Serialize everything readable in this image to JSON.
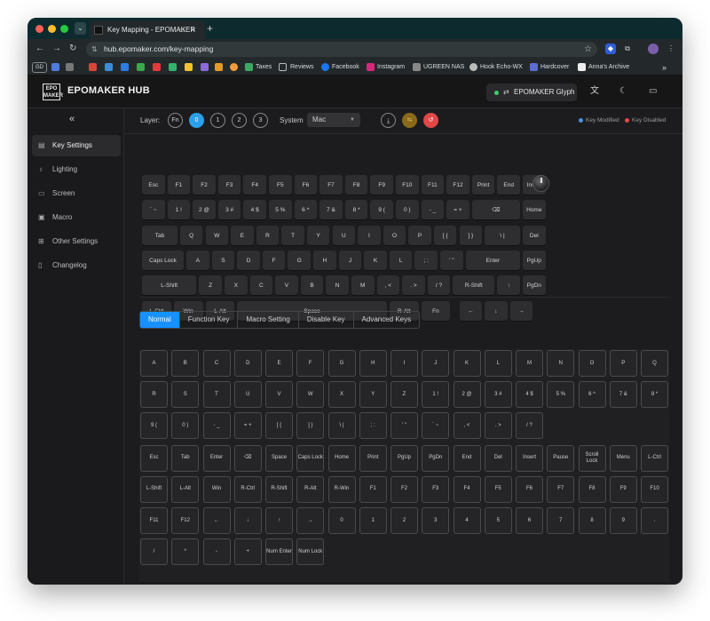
{
  "browser": {
    "tab_title": "Key Mapping - EPOMAKER",
    "url": "hub.epomaker.com/key-mapping",
    "bookmarks": [
      "Taxes",
      "Reviews",
      "Facebook",
      "Instagram",
      "UGREEN NAS",
      "Hook Echo-WX",
      "Hardcover",
      "Anna's Archive"
    ],
    "gd_label": "GD"
  },
  "header": {
    "logo_text": "EPO MAKER",
    "brand": "EPOMAKER HUB",
    "device_name": "EPOMAKER Glyph"
  },
  "sidebar": {
    "items": [
      {
        "label": "Key Settings",
        "icon": "keyboard-icon"
      },
      {
        "label": "Lighting",
        "icon": "bulb-icon"
      },
      {
        "label": "Screen",
        "icon": "monitor-icon"
      },
      {
        "label": "Macro",
        "icon": "macro-icon"
      },
      {
        "label": "Other Settings",
        "icon": "grid-icon"
      },
      {
        "label": "Changelog",
        "icon": "document-icon"
      }
    ]
  },
  "layerbar": {
    "layer_label": "Layer:",
    "layers": [
      "Fn",
      "0",
      "1",
      "2",
      "3"
    ],
    "active_layer": "0",
    "system_label": "System",
    "system_value": "Mac",
    "legend_modified": "Key Modified",
    "legend_disabled": "Key Disabled"
  },
  "keyboard": {
    "rows": [
      [
        "Esc",
        "F1",
        "F2",
        "F3",
        "F4",
        "F5",
        "F6",
        "F7",
        "F8",
        "F9",
        "F10",
        "F11",
        "F12",
        "Print",
        "End",
        "Insert"
      ],
      [
        "` ~",
        "1 !",
        "2 @",
        "3 #",
        "4 $",
        "5 %",
        "6 ^",
        "7 &",
        "8 *",
        "9 (",
        "0 )",
        "- _",
        "= +",
        "⌫",
        "Home"
      ],
      [
        "Tab",
        "Q",
        "W",
        "E",
        "R",
        "T",
        "Y",
        "U",
        "I",
        "O",
        "P",
        "[ {",
        "] }",
        "\\ |",
        "Del"
      ],
      [
        "Caps Lock",
        "A",
        "S",
        "D",
        "F",
        "G",
        "H",
        "J",
        "K",
        "L",
        "; :",
        "' \"",
        "Enter",
        "PgUp"
      ],
      [
        "L-Shift",
        "Z",
        "X",
        "C",
        "V",
        "B",
        "N",
        "M",
        ", <",
        ". >",
        "/ ?",
        "R-Shift",
        "↑",
        "PgDn"
      ],
      [
        "L-Ctrl",
        "Win",
        "L-Alt",
        "Space",
        "R-Alt",
        "Fn",
        "←",
        "↓",
        "→"
      ]
    ]
  },
  "tabs": [
    "Normal",
    "Function Key",
    "Macro Setting",
    "Disable Key",
    "Advanced Keys"
  ],
  "active_tab": "Normal",
  "key_grid": [
    "A",
    "B",
    "C",
    "D",
    "E",
    "F",
    "G",
    "H",
    "I",
    "J",
    "K",
    "L",
    "M",
    "N",
    "O",
    "P",
    "Q",
    "R",
    "S",
    "T",
    "U",
    "V",
    "W",
    "X",
    "Y",
    "Z",
    "1 !",
    "2 @",
    "3 #",
    "4 $",
    "5 %",
    "6 ^",
    "7 &",
    "8 *",
    "9 (",
    "0 )",
    "- _",
    "= +",
    "[ {",
    "] }",
    "\\ |",
    "; :",
    "' \"",
    "` ~",
    ", <",
    ". >",
    "/ ?",
    "Esc",
    "Tab",
    "Enter",
    "⌫",
    "Space",
    "Caps Lock",
    "Home",
    "Print",
    "PgUp",
    "PgDn",
    "End",
    "Del",
    "Insert",
    "Pause",
    "Scroll Lock",
    "Menu",
    "L-Ctrl",
    "L-Shift",
    "L-Alt",
    "Win",
    "R-Ctrl",
    "R-Shift",
    "R-Alt",
    "R-Win",
    "F1",
    "F2",
    "F3",
    "F4",
    "F5",
    "F6",
    "F7",
    "F8",
    "F9",
    "F10",
    "F11",
    "F12",
    "←",
    "↓",
    "↑",
    "→",
    "0",
    "1",
    "2",
    "3",
    "4",
    "5",
    "6",
    "7",
    "8",
    "9",
    ".",
    "/",
    "*",
    "-",
    "+",
    "Num Enter",
    "Num Lock"
  ],
  "colors": {
    "accent": "#1890ff",
    "layer_active": "#2aa0ea",
    "modified": "#4a90e2",
    "disabled": "#e04848"
  }
}
